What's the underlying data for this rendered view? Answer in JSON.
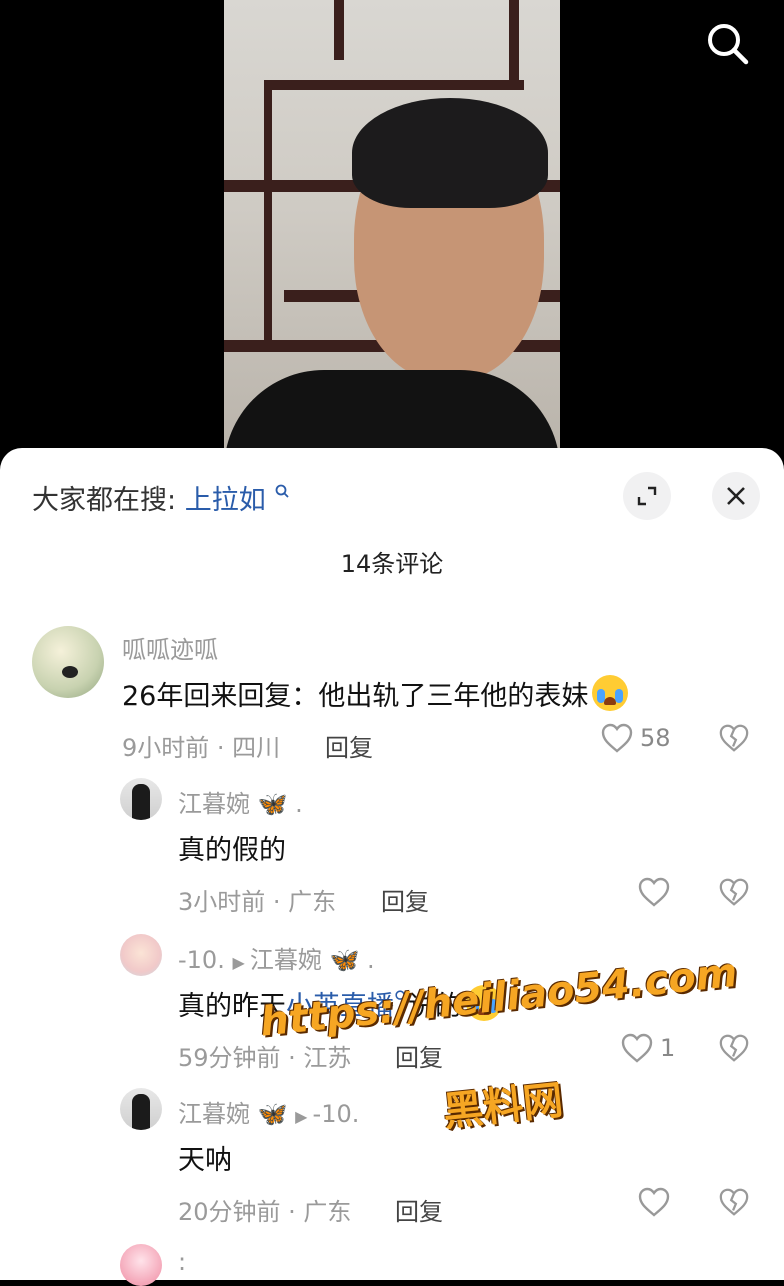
{
  "search_bar": {
    "label": "大家都在搜:",
    "query": "上拉如"
  },
  "comment_count_title": "14条评论",
  "comments": [
    {
      "user": "呱呱迹呱",
      "text": "26年回来回复：他出轨了三年他的表妹",
      "time": "9小时前 · 四川",
      "reply": "回复",
      "likes": "58"
    },
    {
      "user": "江暮婉",
      "text": "真的假的",
      "time": "3小时前 · 广东",
      "reply": "回复",
      "likes": ""
    },
    {
      "user": "-10.",
      "reply_to": "江暮婉",
      "text_before": "真的昨天",
      "text_link": "小英直播",
      "text_after": "说的",
      "time": "59分钟前 · 江苏",
      "reply": "回复",
      "likes": "1"
    },
    {
      "user": "江暮婉",
      "reply_to": "-10.",
      "text": "天呐",
      "time": "20分钟前 · 广东",
      "reply": "回复",
      "likes": ""
    },
    {
      "user": ":"
    }
  ],
  "watermark": {
    "url": "https://heiliao54.com",
    "name": "黑料网"
  },
  "colors": {
    "link": "#2a5caa",
    "secondary": "#9a9a9a",
    "watermark": "#f6a623"
  },
  "icons": [
    "search-icon",
    "expand-icon",
    "close-icon",
    "heart-icon",
    "broken-heart-icon",
    "play-arrow-icon",
    "butterfly-icon",
    "crying-emoji-icon"
  ]
}
